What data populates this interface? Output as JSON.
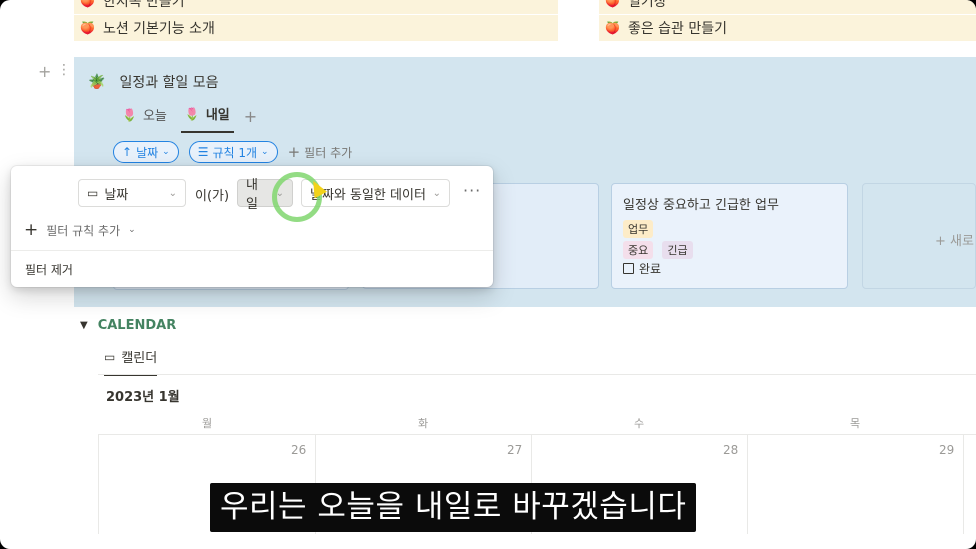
{
  "top_items": {
    "left_partial": "한지옥 만들기",
    "left": "노션 기본기능 소개",
    "right_partial": "일기장",
    "right": "좋은 습관 만들기"
  },
  "database": {
    "title": "일정과 할일 모음",
    "tabs": [
      {
        "label": "오늘",
        "active": false
      },
      {
        "label": "내일",
        "active": true
      }
    ],
    "sort_pill": "날짜",
    "rule_pill": "규칙 1개",
    "add_filter": "필터 추가",
    "card": {
      "title": "일정상 중요하고 긴급한 업무",
      "tags_row1": [
        "업무"
      ],
      "tags_row2": [
        "중요",
        "긴급"
      ],
      "done_label": "완료"
    },
    "new_card": "새로"
  },
  "filter_popup": {
    "field": "날짜",
    "is_text": "이(가)",
    "condition": "내일",
    "value": "날짜와 동일한 데이터",
    "add_rule": "필터 규칙 추가",
    "remove": "필터 제거"
  },
  "calendar": {
    "heading": "CALENDAR",
    "view_tab": "캘린더",
    "month": "2023년 1월",
    "weekdays": [
      "월",
      "화",
      "수",
      "목"
    ],
    "days": [
      "26",
      "27",
      "28",
      "29"
    ]
  },
  "subtitle": "우리는 오늘을 내일로 바꾸겠습니다",
  "colors": {
    "callout_bg": "#d3e5ef",
    "accent_blue": "#2383e2",
    "calendar_green": "#448361",
    "toggle_bg": "#fbf3db"
  }
}
